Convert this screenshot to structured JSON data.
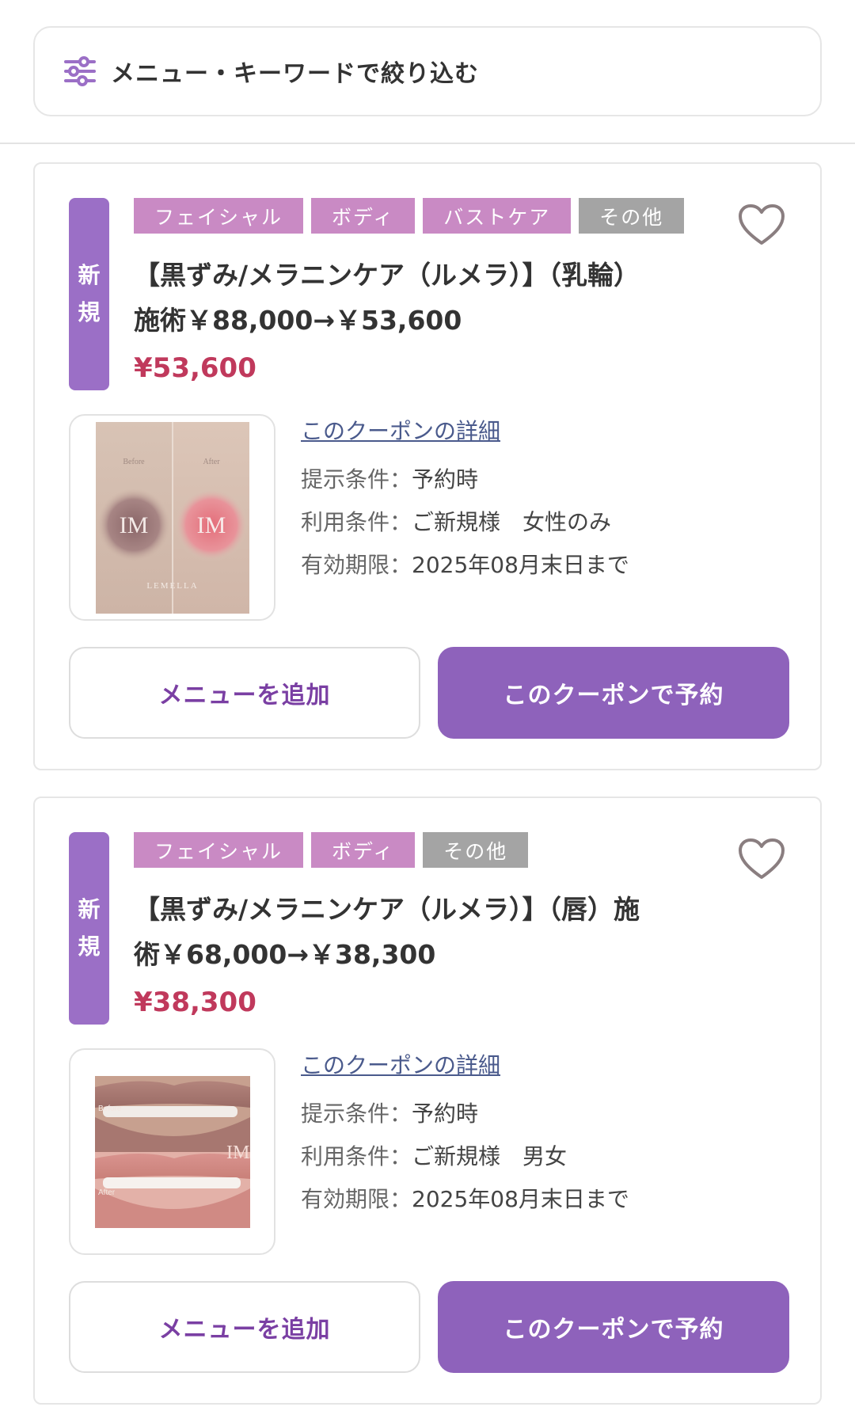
{
  "search": {
    "label": "メニュー・キーワードで絞り込む",
    "icon": "filter-sliders-icon"
  },
  "colors": {
    "accent": "#8e62bb",
    "badge": "#9b6fc6",
    "tag_pink": "#c98ac4",
    "tag_gray": "#a4a4a4",
    "price": "#c0395c"
  },
  "coupons": [
    {
      "badge_chars": [
        "新",
        "規"
      ],
      "tags": [
        {
          "label": "フェイシャル",
          "style": "pink"
        },
        {
          "label": "ボディ",
          "style": "pink"
        },
        {
          "label": "バストケア",
          "style": "pink"
        },
        {
          "label": "その他",
          "style": "gray"
        }
      ],
      "title_line1": "【黒ずみ/メラニンケア（ルメラ）】（乳輪）",
      "title_line2": "施術￥88,000→￥53,600",
      "price": "¥53,600",
      "thumb_text": {
        "before": "Before",
        "after": "After",
        "mark": "IM",
        "brand": "LEMELLA"
      },
      "detail_link": "このクーポンの詳細",
      "present_label": "提示条件：",
      "present_value": "予約時",
      "use_label": "利用条件：",
      "use_value": "ご新規様　女性のみ",
      "expiry_label": "有効期限：",
      "expiry_value": "2025年08月末日まで",
      "add_button": "メニューを追加",
      "book_button": "このクーポンで予約"
    },
    {
      "badge_chars": [
        "新",
        "規"
      ],
      "tags": [
        {
          "label": "フェイシャル",
          "style": "pink"
        },
        {
          "label": "ボディ",
          "style": "pink"
        },
        {
          "label": "その他",
          "style": "gray"
        }
      ],
      "title_line1": "【黒ずみ/メラニンケア（ルメラ）】（唇）施",
      "title_line2": "術￥68,000→￥38,300",
      "price": "¥38,300",
      "thumb_text": {
        "before": "Before",
        "after": "After",
        "mark": "IM"
      },
      "detail_link": "このクーポンの詳細",
      "present_label": "提示条件：",
      "present_value": "予約時",
      "use_label": "利用条件：",
      "use_value": "ご新規様　男女",
      "expiry_label": "有効期限：",
      "expiry_value": "2025年08月末日まで",
      "add_button": "メニューを追加",
      "book_button": "このクーポンで予約"
    }
  ]
}
